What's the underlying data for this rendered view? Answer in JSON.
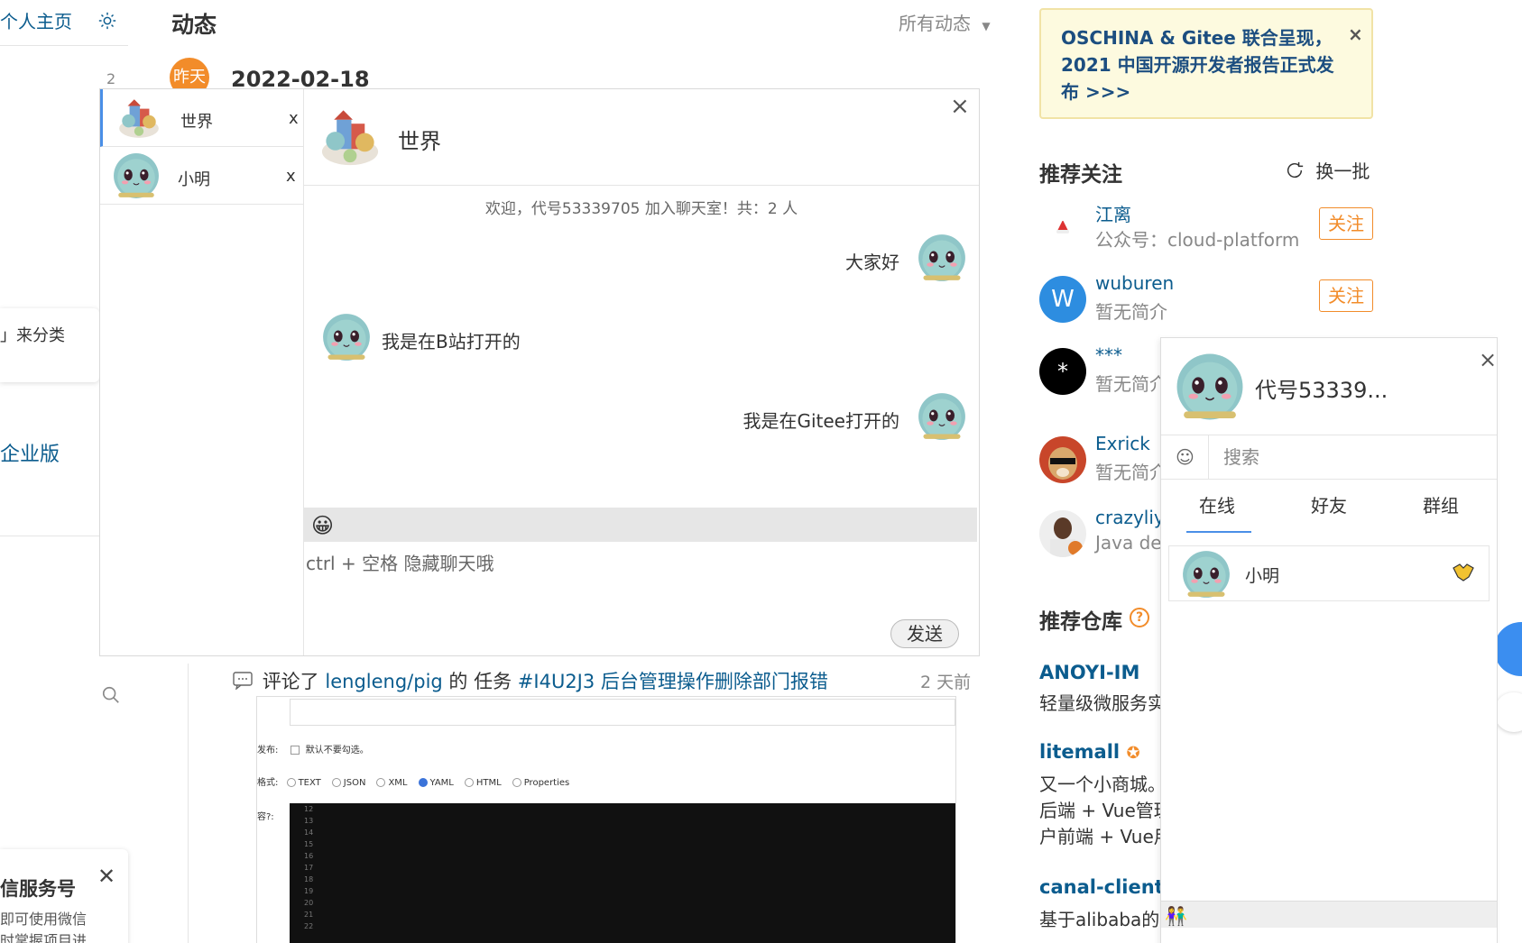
{
  "left": {
    "home_link": "个人主页",
    "badge_num": "2",
    "card_text": "」来分类",
    "enterprise_link": "企业版",
    "wx_title": "信服务号",
    "wx_desc_1": "即可使用微信",
    "wx_desc_2": "时掌握项目进"
  },
  "header": {
    "title": "动态",
    "filter": "所有动态"
  },
  "timeline": {
    "day_label": "昨天",
    "date": "2022-02-18"
  },
  "chat": {
    "sessions": [
      {
        "name": "世界",
        "close": "x"
      },
      {
        "name": "小明",
        "close": "x"
      }
    ],
    "active_name": "世界",
    "system_msg": "欢迎，代号53339705 加入聊天室！共：2 人",
    "messages": [
      {
        "text": "大家好",
        "side": "right"
      },
      {
        "text": "我是在B站打开的",
        "side": "left"
      },
      {
        "text": "我是在Gitee打开的",
        "side": "right"
      }
    ],
    "emoji": "😀",
    "input_placeholder": "ctrl + 空格 隐藏聊天哦",
    "send_label": "发送",
    "close": "×"
  },
  "activity": {
    "prefix": "评论了",
    "repo": "lengleng/pig",
    "middle": "的 任务",
    "task": "#I4U2J3 后台管理操作删除部门报错",
    "time": "2 天前",
    "shot": {
      "row1_label": "发布:",
      "row1_check": "默认不要勾选。",
      "row2_label": "格式:",
      "formats": [
        "TEXT",
        "JSON",
        "XML",
        "YAML",
        "HTML",
        "Properties"
      ],
      "selected_format": "YAML",
      "row3_label": "容?:",
      "line_numbers": [
        "12",
        "13",
        "14",
        "15",
        "16",
        "17",
        "18",
        "19",
        "20",
        "21",
        "22"
      ]
    }
  },
  "banner": {
    "text": "OSCHINA & Gitee 联合呈现，2021 中国开源开发者报告正式发布 >>>",
    "close": "×"
  },
  "recommend": {
    "title": "推荐关注",
    "refresh": "换一批",
    "follow_label": "关注",
    "users": [
      {
        "name": "江离",
        "desc": "公众号：cloud-platform",
        "avatar": "santa-hat",
        "follow": true
      },
      {
        "name": "wuburen",
        "desc": "暂无简介",
        "avatar": "W",
        "avatar_color": "#2d8de0",
        "follow": true
      },
      {
        "name": "***",
        "desc": "暂无简介",
        "avatar": "*",
        "avatar_color": "#000000",
        "follow": false
      },
      {
        "name": "Exrick",
        "desc": "暂无简介",
        "avatar": "dog",
        "follow": false
      },
      {
        "name": "crazyliyang",
        "desc": "Java developer",
        "avatar": "player",
        "follow": false
      }
    ]
  },
  "repos": {
    "title": "推荐仓库",
    "items": [
      {
        "name": "ANOYI-IM",
        "desc": [
          "轻量级微服务实"
        ]
      },
      {
        "name": "litemall",
        "desc": [
          "又一个小商城。",
          "后端 + Vue管理",
          "户前端 + Vue用"
        ]
      },
      {
        "name": "canal-client",
        "desc": [
          "基于alibaba的"
        ]
      }
    ]
  },
  "panel": {
    "me_name": "代号53339...",
    "close": "×",
    "search_placeholder": "搜索",
    "smile": "☺",
    "tabs": [
      "在线",
      "好友",
      "群组"
    ],
    "active_tab": "在线",
    "friends": [
      {
        "name": "小明"
      }
    ],
    "people_icon": "👫"
  },
  "colors": {
    "accent": "#4a8fe7",
    "link": "#0b5c8e",
    "orange": "#f28c2a"
  }
}
